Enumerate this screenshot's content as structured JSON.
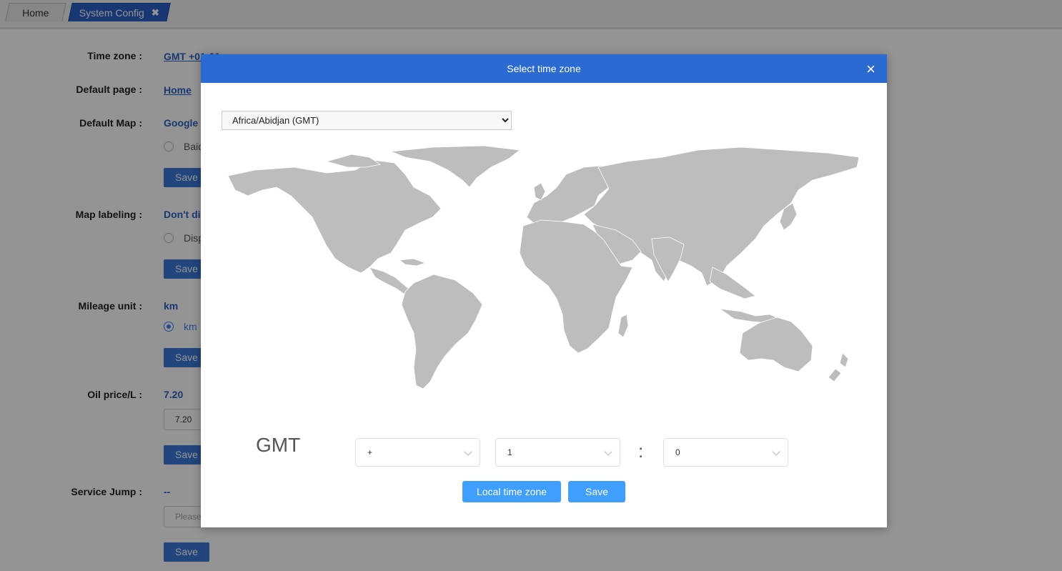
{
  "tabs": {
    "home": "Home",
    "system_config": "System Config",
    "close_glyph": "✖"
  },
  "form": {
    "time_zone": {
      "label": "Time zone :",
      "value": "GMT +01:00"
    },
    "default_page": {
      "label": "Default page :",
      "value": "Home"
    },
    "default_map": {
      "label": "Default Map :",
      "value": "Google",
      "option": "Baid",
      "save": "Save"
    },
    "map_labeling": {
      "label": "Map labeling :",
      "value": "Don't di",
      "option": "Disp",
      "save": "Save"
    },
    "mileage_unit": {
      "label": "Mileage unit :",
      "value": "km",
      "option": "km",
      "save": "Save"
    },
    "oil_price": {
      "label": "Oil price/L :",
      "value": "7.20",
      "input_value": "7.20",
      "save": "Save"
    },
    "service_jump": {
      "label": "Service Jump :",
      "value": "--",
      "placeholder": "Please",
      "save": "Save"
    }
  },
  "modal": {
    "title": "Select time zone",
    "close_glyph": "×",
    "select_value": "Africa/Abidjan (GMT)",
    "gmt_label": "GMT",
    "sign": "+",
    "hours": "1",
    "colon": ":",
    "minutes": "0",
    "local_button": "Local time zone",
    "save_button": "Save"
  },
  "colors": {
    "accent": "#2b6ad0",
    "button": "#409eff",
    "map_land": "#bdbdbd"
  }
}
